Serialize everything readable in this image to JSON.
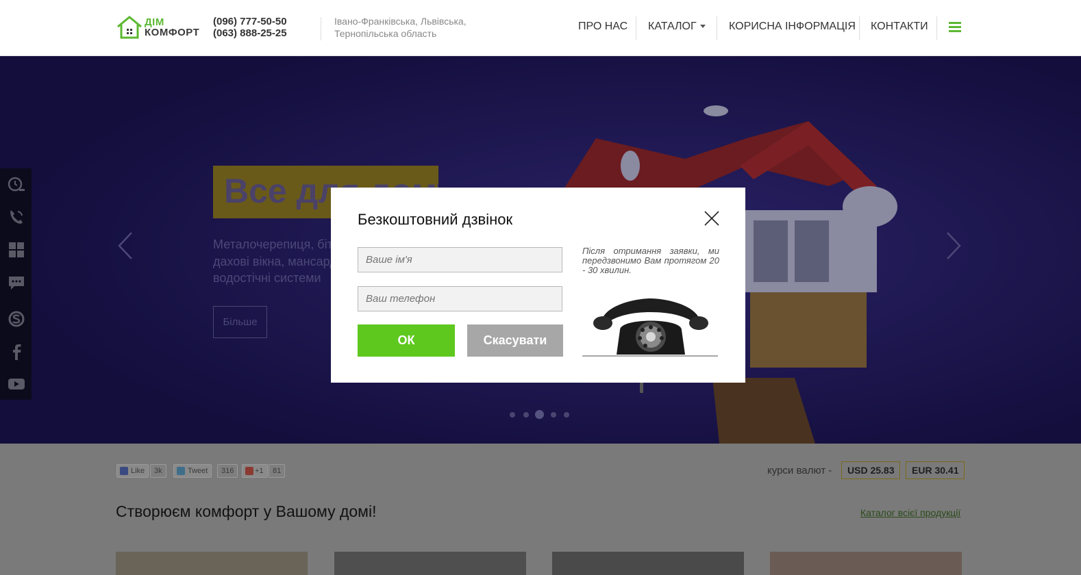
{
  "header": {
    "logo_line1": "ДІМ",
    "logo_line2": "КОМФОРТ",
    "phones": [
      "(096) 777-50-50",
      "(063) 888-25-25"
    ],
    "region_line1": "Івано-Франківська, Львівська,",
    "region_line2": "Тернопільська область",
    "nav": [
      {
        "label": "ПРО НАС"
      },
      {
        "label": "КАТАЛОГ"
      },
      {
        "label": "КОРИСНА ІНФОРМАЦІЯ"
      },
      {
        "label": "КОНТАКТИ"
      }
    ],
    "accent_color": "#5cb832"
  },
  "hero": {
    "title": "Все для дому",
    "lines": [
      "Металочерепиця, бітумна черепиця,",
      "дахові вікна, мансардні сходи,",
      "водостічні системи"
    ],
    "more_label": "Більше",
    "slides_total": 5,
    "active_slide": 3
  },
  "sidebar": {
    "icons": [
      "clock-icon",
      "phone-icon",
      "calculator-icon",
      "chat-icon",
      "skype-icon",
      "facebook-icon",
      "youtube-icon"
    ]
  },
  "social": {
    "like_label": "Like",
    "like_count": "3k",
    "tweet_label": "Tweet",
    "tweet_count": "316",
    "plus_label": "+1",
    "plus_count": "81"
  },
  "rates": {
    "label": "курси валют -",
    "usd": "USD 25.83",
    "eur": "EUR 30.41"
  },
  "section": {
    "title": "Створюєм комфорт у Вашому домі!",
    "catalog_link": "Каталог всієї продукції"
  },
  "modal": {
    "title": "Безкоштовний дзвінок",
    "name_placeholder": "Ваше ім'я",
    "phone_placeholder": "Ваш телефон",
    "ok_label": "ОК",
    "cancel_label": "Скасувати",
    "note": "Після отримання заявки, ми передзвонимо Вам протягом 20 - 30 хвилин.",
    "ok_color": "#5ec81e",
    "cancel_color": "#a7a7a7"
  }
}
